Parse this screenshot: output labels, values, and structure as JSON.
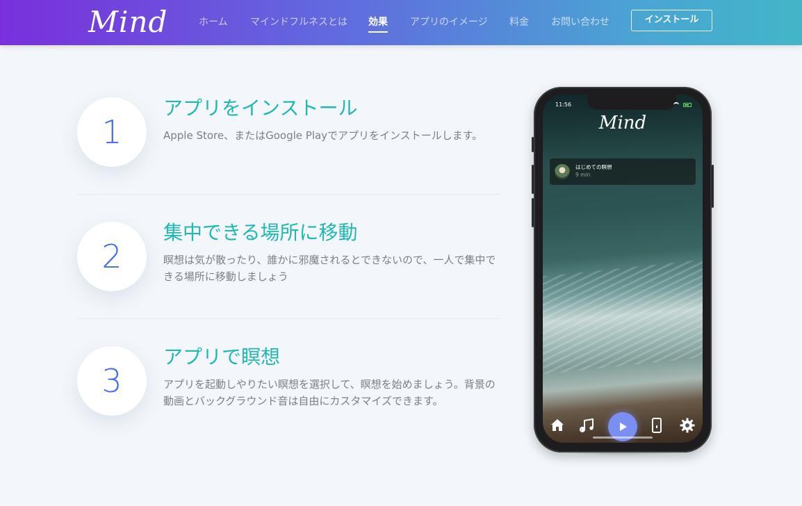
{
  "header": {
    "logo": "Mind",
    "nav": [
      {
        "label": "ホーム",
        "active": false
      },
      {
        "label": "マインドフルネスとは",
        "active": false
      },
      {
        "label": "効果",
        "active": true
      },
      {
        "label": "アプリのイメージ",
        "active": false
      },
      {
        "label": "料金",
        "active": false
      },
      {
        "label": "お問い合わせ",
        "active": false
      }
    ],
    "install_label": "インストール"
  },
  "steps": [
    {
      "number": "1",
      "title": "アプリをインストール",
      "description": "Apple Store、またはGoogle Playでアプリをインストールします。"
    },
    {
      "number": "2",
      "title": "集中できる場所に移動",
      "description": "瞑想は気が散ったり、誰かに邪魔されるとできないので、一人で集中できる場所に移動しましょう"
    },
    {
      "number": "3",
      "title": "アプリで瞑想",
      "description": "アプリを起動しやりたい瞑想を選択して、瞑想を始めましょう。背景の動画とバックグラウンド音は自由にカスタマイズできます。"
    }
  ],
  "phone": {
    "status_time": "11:56",
    "app_logo": "Mind",
    "card": {
      "title": "はじめての瞑想",
      "subtitle": "9 min"
    },
    "tabs": [
      "home-icon",
      "music-note-icon",
      "play-icon",
      "phone-icon",
      "gear-icon"
    ]
  },
  "colors": {
    "header_gradient": [
      "#7a2fdc",
      "#42b6c8"
    ],
    "step_title": "#21b8b3",
    "step_number": "#3d6be6",
    "play_button": "#7b8ff2"
  }
}
